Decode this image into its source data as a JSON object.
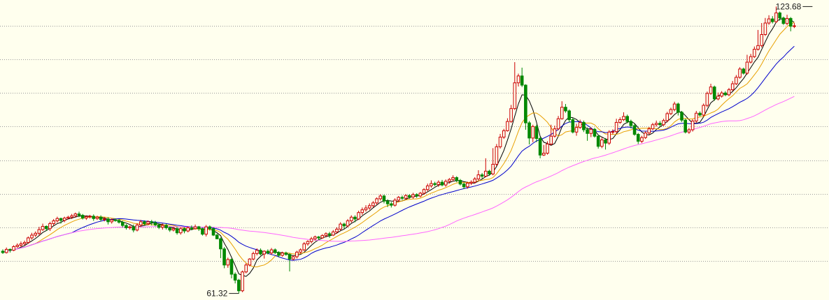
{
  "chart_data": {
    "type": "candlestick",
    "title": "",
    "xlabel": "",
    "ylabel": "",
    "grid": true,
    "legend": "none",
    "ylim": [
      60.5,
      124.5
    ],
    "colors": {
      "background": "#ffffee",
      "grid": "#9a9a9a",
      "up": "#cc0000",
      "down": "#008800",
      "ma5": "#000000",
      "ma10": "#e8a000",
      "ma20": "#0000cc",
      "ma60": "#ff66ff",
      "annotation": "#1a1a1a"
    },
    "candles": [
      [
        70.5,
        70.2,
        70.9,
        69.9
      ],
      [
        70.2,
        70.9,
        71.3,
        70.0
      ],
      [
        70.9,
        70.7,
        71.1,
        70.2
      ],
      [
        70.7,
        71.5,
        71.8,
        70.5
      ],
      [
        71.5,
        71.8,
        72.2,
        71.2
      ],
      [
        71.8,
        72.1,
        72.6,
        71.4
      ],
      [
        72.1,
        72.4,
        72.8,
        71.8
      ],
      [
        72.4,
        73.4,
        73.7,
        72.1
      ],
      [
        73.4,
        74.0,
        74.5,
        73.0
      ],
      [
        74.0,
        74.4,
        74.8,
        73.6
      ],
      [
        74.4,
        75.2,
        75.8,
        73.9
      ],
      [
        75.2,
        75.9,
        76.5,
        74.9
      ],
      [
        75.9,
        75.4,
        76.1,
        74.9
      ],
      [
        75.4,
        76.5,
        76.9,
        74.9
      ],
      [
        76.5,
        77.1,
        77.5,
        76.1
      ],
      [
        77.1,
        77.6,
        78.0,
        76.7
      ],
      [
        77.6,
        77.2,
        77.8,
        76.5
      ],
      [
        77.2,
        77.7,
        78.0,
        76.8
      ],
      [
        77.7,
        77.9,
        78.2,
        77.4
      ],
      [
        77.9,
        78.2,
        78.6,
        77.5
      ],
      [
        78.2,
        78.6,
        78.9,
        77.8
      ],
      [
        78.6,
        78.3,
        79.1,
        77.9
      ],
      [
        78.3,
        77.7,
        78.6,
        77.4
      ],
      [
        77.7,
        78.0,
        78.3,
        77.3
      ],
      [
        78.0,
        78.1,
        78.4,
        77.6
      ],
      [
        78.1,
        77.6,
        78.5,
        77.1
      ],
      [
        77.6,
        77.9,
        78.2,
        77.3
      ],
      [
        77.9,
        77.4,
        78.3,
        77.0
      ],
      [
        77.4,
        77.5,
        77.9,
        77.0
      ],
      [
        77.5,
        76.9,
        77.9,
        76.3
      ],
      [
        76.9,
        77.3,
        77.6,
        76.5
      ],
      [
        77.3,
        77.2,
        77.6,
        76.9
      ],
      [
        77.2,
        76.8,
        77.5,
        76.5
      ],
      [
        76.8,
        76.1,
        77.1,
        75.7
      ],
      [
        76.1,
        75.6,
        76.4,
        75.2
      ],
      [
        75.6,
        75.8,
        76.1,
        75.2
      ],
      [
        75.8,
        75.1,
        76.3,
        74.6
      ],
      [
        75.1,
        76.2,
        76.6,
        74.8
      ],
      [
        76.2,
        76.9,
        77.3,
        75.8
      ],
      [
        76.9,
        76.5,
        77.2,
        76.1
      ],
      [
        76.5,
        76.9,
        77.2,
        76.1
      ],
      [
        76.9,
        76.7,
        77.3,
        76.1
      ],
      [
        76.7,
        76.2,
        77.1,
        75.9
      ],
      [
        76.2,
        75.7,
        76.6,
        75.3
      ],
      [
        75.7,
        76.1,
        76.5,
        75.2
      ],
      [
        76.1,
        75.6,
        76.5,
        75.2
      ],
      [
        75.6,
        75.1,
        75.9,
        74.7
      ],
      [
        75.1,
        75.4,
        75.8,
        74.8
      ],
      [
        75.4,
        74.5,
        75.8,
        74.1
      ],
      [
        74.5,
        75.4,
        75.7,
        74.1
      ],
      [
        75.4,
        74.9,
        75.7,
        74.4
      ],
      [
        74.9,
        75.6,
        75.9,
        74.6
      ],
      [
        75.6,
        75.4,
        76.1,
        75.1
      ],
      [
        75.4,
        75.8,
        76.3,
        75.2
      ],
      [
        75.8,
        75.4,
        76.0,
        74.9
      ],
      [
        75.4,
        74.2,
        75.6,
        73.9
      ],
      [
        74.2,
        75.8,
        76.2,
        73.7
      ],
      [
        75.8,
        75.4,
        76.1,
        75.0
      ],
      [
        75.4,
        74.0,
        75.7,
        73.8
      ],
      [
        74.0,
        73.2,
        74.3,
        73.1
      ],
      [
        73.2,
        71.0,
        73.5,
        69.0
      ],
      [
        71.0,
        67.5,
        71.4,
        66.8
      ],
      [
        67.5,
        68.7,
        69.1,
        66.9
      ],
      [
        68.7,
        65.5,
        68.9,
        64.6
      ],
      [
        65.5,
        64.2,
        65.9,
        63.5
      ],
      [
        64.2,
        61.9,
        64.5,
        61.3
      ],
      [
        61.9,
        66.0,
        66.3,
        61.6
      ],
      [
        66.0,
        67.5,
        67.9,
        65.7
      ],
      [
        67.5,
        68.8,
        69.0,
        67.2
      ],
      [
        68.8,
        70.0,
        70.4,
        68.5
      ],
      [
        70.0,
        70.7,
        71.1,
        69.6
      ],
      [
        70.7,
        69.9,
        71.1,
        69.6
      ],
      [
        69.9,
        70.5,
        70.7,
        68.9
      ],
      [
        70.5,
        70.1,
        70.9,
        69.8
      ],
      [
        70.1,
        70.8,
        71.2,
        69.7
      ],
      [
        70.8,
        70.2,
        71.1,
        69.9
      ],
      [
        70.2,
        69.6,
        70.5,
        69.2
      ],
      [
        69.6,
        70.1,
        70.4,
        69.3
      ],
      [
        70.1,
        69.8,
        70.4,
        69.5
      ],
      [
        69.8,
        68.8,
        70.1,
        66.1
      ],
      [
        68.8,
        69.3,
        69.6,
        68.5
      ],
      [
        69.3,
        70.3,
        70.6,
        68.9
      ],
      [
        70.3,
        70.8,
        71.1,
        70.0
      ],
      [
        70.8,
        72.1,
        72.5,
        70.5
      ],
      [
        72.1,
        72.6,
        72.9,
        71.7
      ],
      [
        72.6,
        73.2,
        73.6,
        72.2
      ],
      [
        73.2,
        73.6,
        73.9,
        72.8
      ],
      [
        73.6,
        73.4,
        73.8,
        72.9
      ],
      [
        73.4,
        73.9,
        74.2,
        73.2
      ],
      [
        73.9,
        74.3,
        74.6,
        73.5
      ],
      [
        74.3,
        74.0,
        74.7,
        73.4
      ],
      [
        74.0,
        74.7,
        75.1,
        73.8
      ],
      [
        74.7,
        75.3,
        75.7,
        74.3
      ],
      [
        75.3,
        76.4,
        76.8,
        75.0
      ],
      [
        76.4,
        76.0,
        76.7,
        75.4
      ],
      [
        76.0,
        77.1,
        77.5,
        75.7
      ],
      [
        77.1,
        77.9,
        78.3,
        76.7
      ],
      [
        77.9,
        77.5,
        78.3,
        76.8
      ],
      [
        77.5,
        78.9,
        79.3,
        77.3
      ],
      [
        78.9,
        79.5,
        80.0,
        78.4
      ],
      [
        79.5,
        79.9,
        80.5,
        79.1
      ],
      [
        79.9,
        80.4,
        80.9,
        79.5
      ],
      [
        80.4,
        81.0,
        81.4,
        80.0
      ],
      [
        81.0,
        81.9,
        82.2,
        80.6
      ],
      [
        81.9,
        82.5,
        82.9,
        81.5
      ],
      [
        82.5,
        81.4,
        82.8,
        80.9
      ],
      [
        81.4,
        80.8,
        81.8,
        80.1
      ],
      [
        80.8,
        80.5,
        81.2,
        80.0
      ],
      [
        80.5,
        81.6,
        82.0,
        80.2
      ],
      [
        81.6,
        82.2,
        82.5,
        81.2
      ],
      [
        82.2,
        82.0,
        82.6,
        81.6
      ],
      [
        82.0,
        82.6,
        82.9,
        81.7
      ],
      [
        82.6,
        82.3,
        82.9,
        81.9
      ],
      [
        82.3,
        82.8,
        83.2,
        81.9
      ],
      [
        82.8,
        82.5,
        83.1,
        82.1
      ],
      [
        82.5,
        83.1,
        83.4,
        82.2
      ],
      [
        83.1,
        83.9,
        84.2,
        82.8
      ],
      [
        83.9,
        84.7,
        85.2,
        83.5
      ],
      [
        84.7,
        85.2,
        85.9,
        84.3
      ],
      [
        85.2,
        85.0,
        85.6,
        84.6
      ],
      [
        85.0,
        85.5,
        85.9,
        84.5
      ],
      [
        85.5,
        84.9,
        86.0,
        84.6
      ],
      [
        84.9,
        85.7,
        86.1,
        84.5
      ],
      [
        85.7,
        86.1,
        86.4,
        85.2
      ],
      [
        86.1,
        86.5,
        87.0,
        85.7
      ],
      [
        86.5,
        85.9,
        86.8,
        85.5
      ],
      [
        85.9,
        85.1,
        86.2,
        84.8
      ],
      [
        85.1,
        84.5,
        85.4,
        84.0
      ],
      [
        84.5,
        85.3,
        85.6,
        84.1
      ],
      [
        85.3,
        85.5,
        85.9,
        84.9
      ],
      [
        85.5,
        86.2,
        86.6,
        85.2
      ],
      [
        86.2,
        87.1,
        88.1,
        85.8
      ],
      [
        87.1,
        86.8,
        87.5,
        86.3
      ],
      [
        86.8,
        87.9,
        90.7,
        86.6
      ],
      [
        87.9,
        87.3,
        88.2,
        86.9
      ],
      [
        87.3,
        89.4,
        92.9,
        87.0
      ],
      [
        89.4,
        93.2,
        93.8,
        89.0
      ],
      [
        93.2,
        95.3,
        96.0,
        92.8
      ],
      [
        95.3,
        96.7,
        97.1,
        94.9
      ],
      [
        96.7,
        98.7,
        99.4,
        96.5
      ],
      [
        98.7,
        101.5,
        102.3,
        98.4
      ],
      [
        101.5,
        107.1,
        111.6,
        101.2
      ],
      [
        107.1,
        108.6,
        109.1,
        106.3
      ],
      [
        108.6,
        106.6,
        110.4,
        106.2
      ],
      [
        106.6,
        98.4,
        106.8,
        96.9
      ],
      [
        98.4,
        95.1,
        98.8,
        93.7
      ],
      [
        95.1,
        97.6,
        98.0,
        94.2
      ],
      [
        97.6,
        95.0,
        98.0,
        94.2
      ],
      [
        95.0,
        91.4,
        95.4,
        90.7
      ],
      [
        91.4,
        91.8,
        93.6,
        91.2
      ],
      [
        91.8,
        93.8,
        94.4,
        91.5
      ],
      [
        93.8,
        95.5,
        98.0,
        93.5
      ],
      [
        95.5,
        97.1,
        97.8,
        95.2
      ],
      [
        97.1,
        99.3,
        99.9,
        96.8
      ],
      [
        99.3,
        101.8,
        103.1,
        99.1
      ],
      [
        101.8,
        101.0,
        102.5,
        100.6
      ],
      [
        101.0,
        99.1,
        101.3,
        98.5
      ],
      [
        99.1,
        96.4,
        99.5,
        96.1
      ],
      [
        96.4,
        97.4,
        98.2,
        95.6
      ],
      [
        97.4,
        98.5,
        99.1,
        97.1
      ],
      [
        98.5,
        96.9,
        98.9,
        96.4
      ],
      [
        96.9,
        96.1,
        97.4,
        94.5
      ],
      [
        96.1,
        97.0,
        97.4,
        95.3
      ],
      [
        97.0,
        95.5,
        97.3,
        95.2
      ],
      [
        95.5,
        93.3,
        95.8,
        92.8
      ],
      [
        93.3,
        94.7,
        95.2,
        92.9
      ],
      [
        94.7,
        94.0,
        95.1,
        92.6
      ],
      [
        94.0,
        96.4,
        96.8,
        93.6
      ],
      [
        96.4,
        96.5,
        97.0,
        95.9
      ],
      [
        96.5,
        98.5,
        99.3,
        96.1
      ],
      [
        98.5,
        99.1,
        99.6,
        98.2
      ],
      [
        99.1,
        99.8,
        100.7,
        98.8
      ],
      [
        99.8,
        98.7,
        100.2,
        98.3
      ],
      [
        98.7,
        97.8,
        99.1,
        97.2
      ],
      [
        97.8,
        95.9,
        98.2,
        95.6
      ],
      [
        95.9,
        94.4,
        96.2,
        93.8
      ],
      [
        94.4,
        95.2,
        95.6,
        94.0
      ],
      [
        95.2,
        96.2,
        96.6,
        94.9
      ],
      [
        96.2,
        97.1,
        97.5,
        95.8
      ],
      [
        97.1,
        98.0,
        98.4,
        96.8
      ],
      [
        98.0,
        98.3,
        98.9,
        97.6
      ],
      [
        98.3,
        98.0,
        98.8,
        97.7
      ],
      [
        98.0,
        98.9,
        99.3,
        97.7
      ],
      [
        98.9,
        100.4,
        100.8,
        98.5
      ],
      [
        100.4,
        101.3,
        101.7,
        100.1
      ],
      [
        101.3,
        102.5,
        103.0,
        100.9
      ],
      [
        102.5,
        100.7,
        102.8,
        100.0
      ],
      [
        100.7,
        99.0,
        101.0,
        98.6
      ],
      [
        99.0,
        96.4,
        99.3,
        96.1
      ],
      [
        96.4,
        96.9,
        97.3,
        96.0
      ],
      [
        96.9,
        98.8,
        99.2,
        96.5
      ],
      [
        98.8,
        100.5,
        101.0,
        98.4
      ],
      [
        100.5,
        100.1,
        100.9,
        99.8
      ],
      [
        100.1,
        102.2,
        102.6,
        99.8
      ],
      [
        102.2,
        104.8,
        105.2,
        101.8
      ],
      [
        104.8,
        106.2,
        106.9,
        104.5
      ],
      [
        106.2,
        103.6,
        106.5,
        103.2
      ],
      [
        103.6,
        104.2,
        105.0,
        103.3
      ],
      [
        104.2,
        104.9,
        105.3,
        103.9
      ],
      [
        104.9,
        104.5,
        105.3,
        104.2
      ],
      [
        104.5,
        105.6,
        106.0,
        104.2
      ],
      [
        105.6,
        106.9,
        107.5,
        105.3
      ],
      [
        106.9,
        108.3,
        108.8,
        106.6
      ],
      [
        108.3,
        110.1,
        110.5,
        108.0
      ],
      [
        110.1,
        109.2,
        110.4,
        108.9
      ],
      [
        109.2,
        111.6,
        113.2,
        108.9
      ],
      [
        111.6,
        112.8,
        113.4,
        111.3
      ],
      [
        112.8,
        114.4,
        115.0,
        112.5
      ],
      [
        114.4,
        115.2,
        118.6,
        114.1
      ],
      [
        115.2,
        117.6,
        120.1,
        114.8
      ],
      [
        117.6,
        120.1,
        121.2,
        117.3
      ],
      [
        120.1,
        121.0,
        121.8,
        119.7
      ],
      [
        121.0,
        120.4,
        121.6,
        120.0
      ],
      [
        120.4,
        122.3,
        123.68,
        120.1
      ],
      [
        122.3,
        121.2,
        122.6,
        120.6
      ],
      [
        121.2,
        120.0,
        121.5,
        119.7
      ],
      [
        120.0,
        121.1,
        121.9,
        119.6
      ],
      [
        121.1,
        119.4,
        121.4,
        118.3
      ],
      [
        119.4,
        119.5,
        120.1,
        119.0
      ]
    ],
    "annotations": [
      {
        "text": "123.68",
        "value": 123.68,
        "candle_index": 223,
        "marker": "high"
      },
      {
        "text": "61.32",
        "value": 61.32,
        "candle_index": 65,
        "marker": "low"
      }
    ],
    "gridlines": [
      68.4,
      75.7,
      83.0,
      90.3,
      97.6,
      104.9,
      112.2,
      119.5
    ],
    "moving_averages": [
      {
        "period": 5,
        "color_key": "ma5"
      },
      {
        "period": 10,
        "color_key": "ma10"
      },
      {
        "period": 20,
        "color_key": "ma20"
      },
      {
        "period": 60,
        "color_key": "ma60"
      }
    ]
  }
}
